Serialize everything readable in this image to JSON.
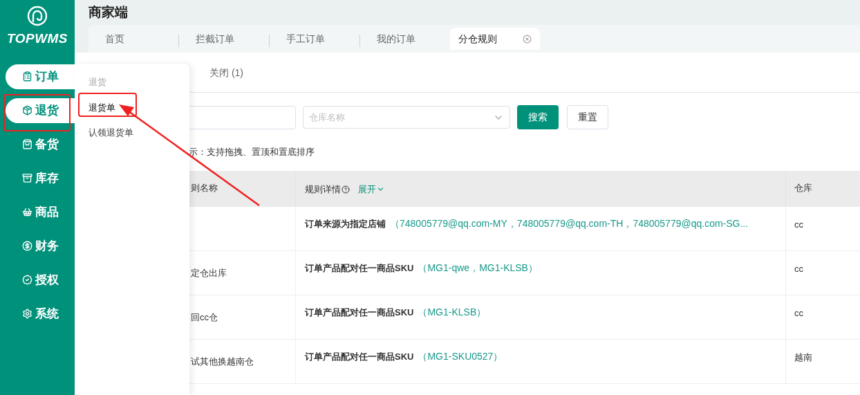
{
  "sidebar": {
    "brand": "TOPWMS",
    "items": [
      {
        "label": "订单",
        "active": true
      },
      {
        "label": "退货",
        "active": true
      },
      {
        "label": "备货",
        "active": false
      },
      {
        "label": "库存",
        "active": false
      },
      {
        "label": "商品",
        "active": false
      },
      {
        "label": "财务",
        "active": false
      },
      {
        "label": "授权",
        "active": false
      },
      {
        "label": "系统",
        "active": false
      }
    ]
  },
  "header": {
    "title": "商家端"
  },
  "page_tabs": [
    {
      "label": "首页",
      "selected": false
    },
    {
      "label": "拦截订单",
      "selected": false
    },
    {
      "label": "手工订单",
      "selected": false
    },
    {
      "label": "我的订单",
      "selected": false
    },
    {
      "label": "分仓规则",
      "selected": true
    }
  ],
  "flyout_menu": {
    "group_title": "退货",
    "items": [
      {
        "label": "退货单",
        "selected": true
      },
      {
        "label": "认领退货单",
        "selected": false
      }
    ]
  },
  "status_tabs": [
    {
      "label": "关闭 (1)",
      "selected": false
    }
  ],
  "filters": {
    "warehouse_placeholder": "仓库名称",
    "search_button": "搜索",
    "reset_button": "重置"
  },
  "hint": "示：支持拖拽、置顶和置底排序",
  "table": {
    "columns": [
      "则名称",
      "规则详情",
      "仓库"
    ],
    "expand_link": "展开",
    "rows": [
      {
        "rule": "订单来源为指定店铺",
        "values": "（748005779@qq.com-MY，748005779@qq.com-TH，748005779@qq.com-SG...",
        "warehouse": "cc"
      },
      {
        "name": "定仓出库",
        "rule": "订单产品配对任一商品SKU",
        "values": "（MG1-qwe，MG1-KLSB）",
        "warehouse": "cc"
      },
      {
        "name": "回cc仓",
        "rule": "订单产品配对任一商品SKU",
        "values": "（MG1-KLSB）",
        "warehouse": "cc"
      },
      {
        "name": "试其他换越南仓",
        "rule": "订单产品配对任一商品SKU",
        "values": "（MG1-SKU0527）",
        "warehouse": "越南"
      }
    ]
  }
}
